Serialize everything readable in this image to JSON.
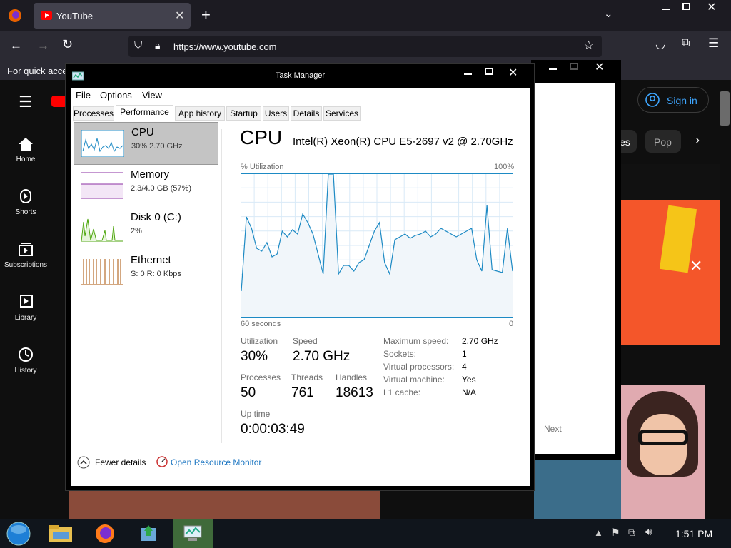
{
  "browser": {
    "tab_title": "YouTube",
    "url": "https://www.youtube.com",
    "bookmarks_text": "For quick acces"
  },
  "youtube": {
    "sidebar": [
      {
        "label": "Home",
        "icon": "home-icon"
      },
      {
        "label": "Shorts",
        "icon": "shorts-icon"
      },
      {
        "label": "Subscriptions",
        "icon": "subscriptions-icon"
      },
      {
        "label": "Library",
        "icon": "library-icon"
      },
      {
        "label": "History",
        "icon": "history-icon"
      }
    ],
    "sign_in": "Sign in",
    "chip_partial": "es",
    "chip_pop": "Pop"
  },
  "popup": {
    "next": "Next"
  },
  "taskmanager": {
    "title": "Task Manager",
    "menu": [
      "File",
      "Options",
      "View"
    ],
    "tabs": [
      "Processes",
      "Performance",
      "App history",
      "Startup",
      "Users",
      "Details",
      "Services"
    ],
    "resources": [
      {
        "name": "CPU",
        "value": "30%  2.70 GHz",
        "color": "#1d8ac4"
      },
      {
        "name": "Memory",
        "value": "2.3/4.0 GB (57%)",
        "color": "#8b2fa3"
      },
      {
        "name": "Disk 0 (C:)",
        "value": "2%",
        "color": "#4da60c"
      },
      {
        "name": "Ethernet",
        "value": "S: 0  R: 0 Kbps",
        "color": "#a74f01"
      }
    ],
    "heading": "CPU",
    "processor": "Intel(R) Xeon(R) CPU E5-2697 v2 @ 2.70GHz",
    "graph": {
      "ylabel": "% Utilization",
      "ymax_label": "100%",
      "xlabel_left": "60 seconds",
      "xlabel_right": "0",
      "series": [
        18,
        70,
        62,
        48,
        46,
        52,
        42,
        44,
        60,
        56,
        61,
        58,
        72,
        66,
        58,
        44,
        30,
        100,
        100,
        30,
        36,
        36,
        32,
        38,
        40,
        50,
        60,
        66,
        38,
        30,
        54,
        56,
        58,
        55,
        57,
        58,
        60,
        56,
        58,
        62,
        60,
        58,
        56,
        58,
        60,
        62,
        40,
        32,
        78,
        33,
        32,
        31,
        62,
        32
      ]
    },
    "stats": {
      "utilization_label": "Utilization",
      "utilization": "30%",
      "speed_label": "Speed",
      "speed": "2.70 GHz",
      "processes_label": "Processes",
      "processes": "50",
      "threads_label": "Threads",
      "threads": "761",
      "handles_label": "Handles",
      "handles": "18613",
      "uptime_label": "Up time",
      "uptime": "0:00:03:49"
    },
    "specs": [
      {
        "k": "Maximum speed:",
        "v": "2.70 GHz"
      },
      {
        "k": "Sockets:",
        "v": "1"
      },
      {
        "k": "Virtual processors:",
        "v": "4"
      },
      {
        "k": "Virtual machine:",
        "v": "Yes"
      },
      {
        "k": "L1 cache:",
        "v": "N/A"
      }
    ],
    "fewer_details": "Fewer details",
    "open_resource_monitor": "Open Resource Monitor"
  },
  "taskbar": {
    "time": "1:51 PM"
  }
}
